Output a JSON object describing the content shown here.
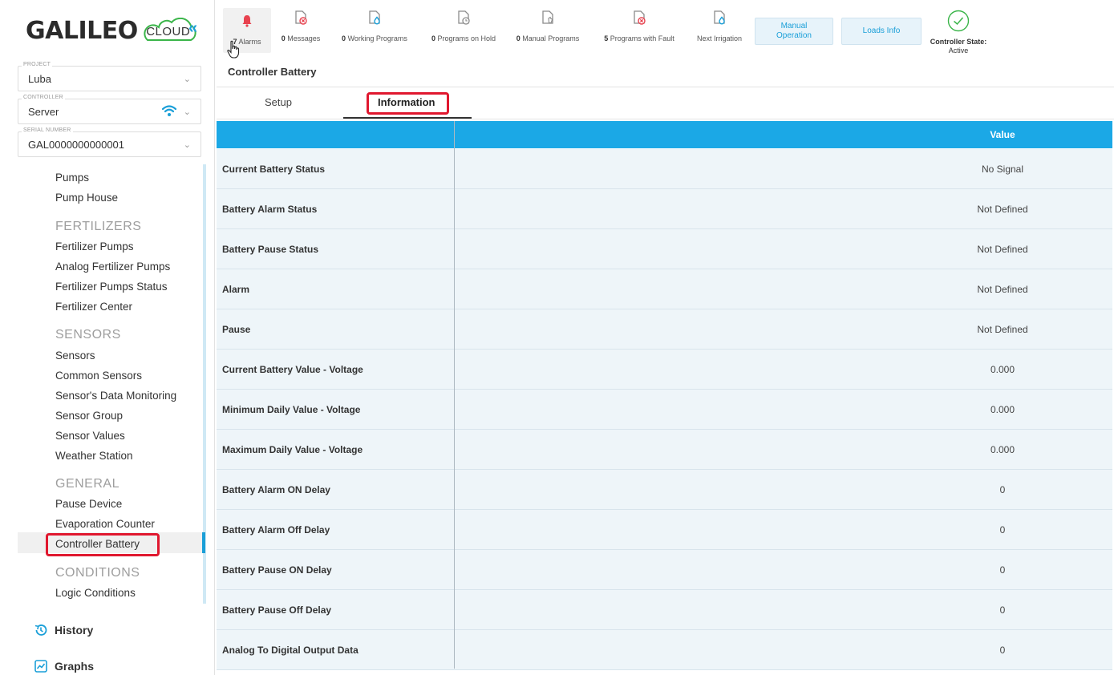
{
  "sidebar": {
    "logo": {
      "brand": "GALILEO",
      "cloud": "CLOUD"
    },
    "collapse": "«",
    "project": {
      "label": "PROJECT",
      "value": "Luba"
    },
    "controller": {
      "label": "CONTROLLER",
      "value": "Server"
    },
    "serial": {
      "label": "SERIAL NUMBER",
      "value": "GAL0000000000001"
    },
    "nav": {
      "pumps": "Pumps",
      "pump_house": "Pump House",
      "fertilizers_head": "FERTILIZERS",
      "fertilizer_pumps": "Fertilizer Pumps",
      "analog_fertilizer_pumps": "Analog Fertilizer Pumps",
      "fertilizer_pumps_status": "Fertilizer Pumps Status",
      "fertilizer_center": "Fertilizer Center",
      "sensors_head": "SENSORS",
      "sensors": "Sensors",
      "common_sensors": "Common Sensors",
      "sensor_data_monitoring": "Sensor's Data Monitoring",
      "sensor_group": "Sensor Group",
      "sensor_values": "Sensor Values",
      "weather_station": "Weather Station",
      "general_head": "GENERAL",
      "pause_device": "Pause Device",
      "evaporation_counter": "Evaporation Counter",
      "controller_battery": "Controller Battery",
      "conditions_head": "CONDITIONS",
      "logic_conditions": "Logic Conditions"
    },
    "history": "History",
    "graphs": "Graphs"
  },
  "topbar": {
    "alarms": {
      "count": "7",
      "label": "Alarms"
    },
    "messages": {
      "count": "0",
      "label": "Messages"
    },
    "working_programs": {
      "count": "0",
      "label": "Working Programs"
    },
    "programs_on_hold": {
      "count": "0",
      "label": "Programs on Hold"
    },
    "manual_programs": {
      "count": "0",
      "label": "Manual Programs"
    },
    "programs_with_fault": {
      "count": "5",
      "label": "Programs with Fault"
    },
    "next_irrigation": {
      "label": "Next Irrigation"
    },
    "manual_operation": {
      "line1": "Manual",
      "line2": "Operation"
    },
    "loads_info": "Loads Info",
    "controller_state": {
      "line1": "Controller State:",
      "line2": "Active"
    }
  },
  "page": {
    "title": "Controller Battery",
    "tabs": {
      "setup": "Setup",
      "information": "Information"
    },
    "active_tab": "Information"
  },
  "table": {
    "header_value": "Value",
    "rows": [
      {
        "key": "Current Battery Status",
        "value": "No Signal"
      },
      {
        "key": "Battery Alarm Status",
        "value": "Not Defined"
      },
      {
        "key": "Battery Pause Status",
        "value": "Not Defined"
      },
      {
        "key": "Alarm",
        "value": "Not Defined"
      },
      {
        "key": "Pause",
        "value": "Not Defined"
      },
      {
        "key": "Current Battery Value - Voltage",
        "value": "0.000"
      },
      {
        "key": "Minimum Daily Value - Voltage",
        "value": "0.000"
      },
      {
        "key": "Maximum Daily Value - Voltage",
        "value": "0.000"
      },
      {
        "key": "Battery Alarm ON Delay",
        "value": "0"
      },
      {
        "key": "Battery Alarm Off Delay",
        "value": "0"
      },
      {
        "key": "Battery Pause ON Delay",
        "value": "0"
      },
      {
        "key": "Battery Pause Off Delay",
        "value": "0"
      },
      {
        "key": "Analog To Digital Output Data",
        "value": "0"
      }
    ]
  },
  "colors": {
    "accent": "#1ba8e6",
    "highlight_box": "#e0182f",
    "alarm": "#e8424f",
    "row_bg": "#eef5f9",
    "state_ok": "#3bb54a"
  },
  "icons": {
    "alarms": "bell-icon",
    "messages": "message-error-icon",
    "working_programs": "program-drop-icon",
    "programs_on_hold": "program-clock-icon",
    "manual_programs": "program-manual-icon",
    "programs_with_fault": "program-fault-icon",
    "next_irrigation": "program-drop-icon",
    "controller_state": "check-circle-icon",
    "controller_wifi": "wifi-icon",
    "history": "history-icon",
    "graphs": "graph-icon",
    "cursor": "hand-pointer-icon"
  }
}
